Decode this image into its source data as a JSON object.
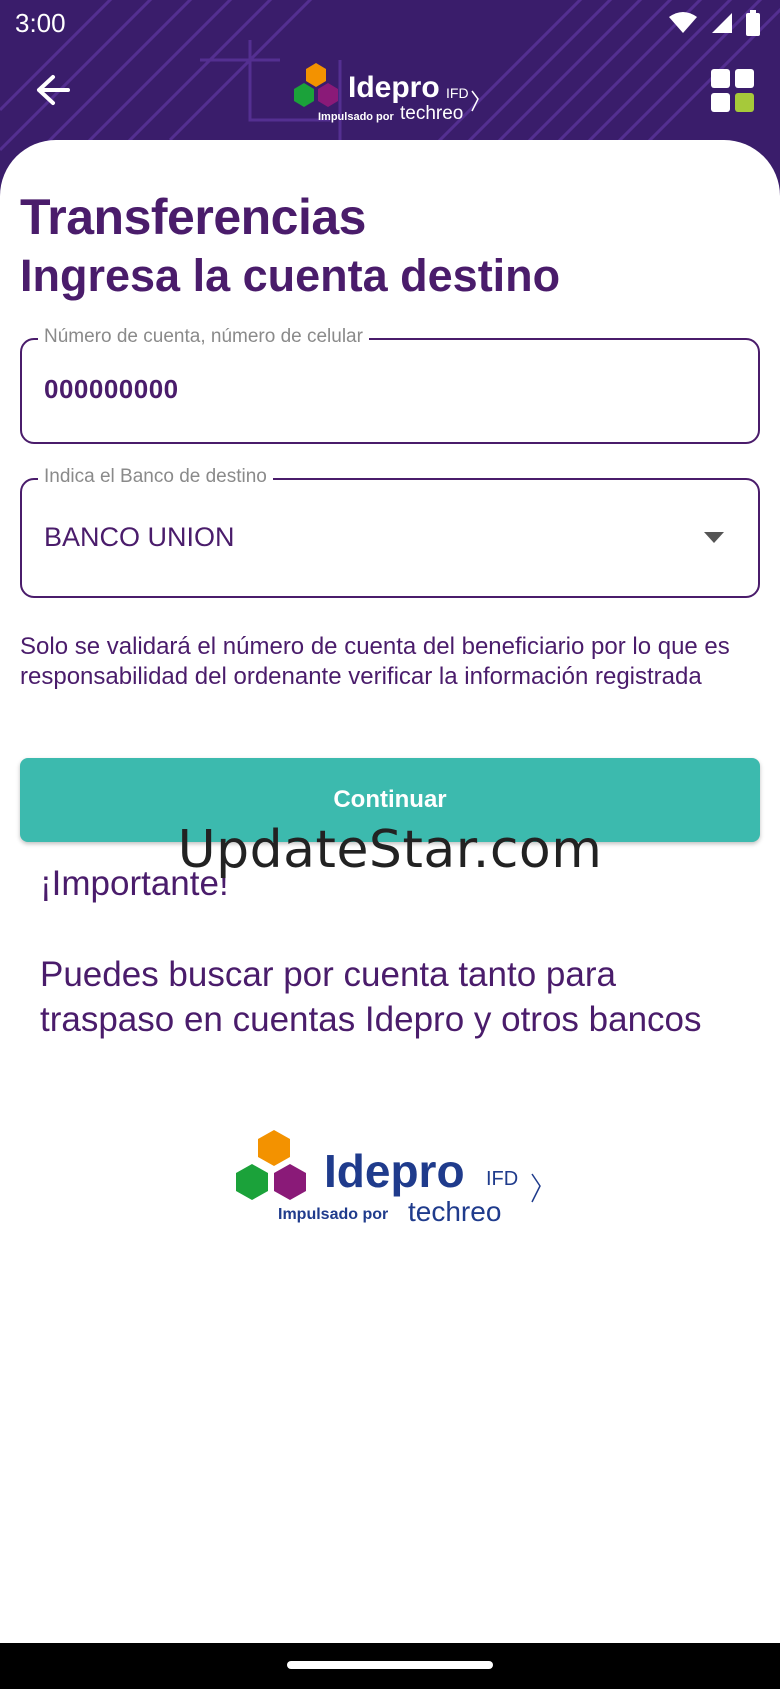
{
  "status_bar": {
    "time": "3:00"
  },
  "header": {
    "logo_brand": "Idepro",
    "logo_suffix": "IFD",
    "logo_tagline_prefix": "Impulsado por",
    "logo_tagline_brand": "techreo"
  },
  "main": {
    "title": "Transferencias",
    "subtitle": "Ingresa la cuenta destino",
    "account_field": {
      "label": "Número de cuenta, número de celular",
      "value": "000000000"
    },
    "bank_field": {
      "label": "Indica el Banco de destino",
      "selected": "BANCO UNION"
    },
    "disclaimer": "Solo se validará el número de cuenta del beneficiario por lo que es responsabilidad del ordenante verificar la información registrada",
    "continue_label": "Continuar",
    "watermark": "UpdateStar.com",
    "important_title": "¡Importante!",
    "important_body": "Puedes buscar por cuenta tanto para traspaso en cuentas Idepro y otros bancos"
  },
  "colors": {
    "primary": "#4a1c6b",
    "header_bg": "#3a1d6b",
    "accent": "#3cbaae",
    "logo_orange": "#f39200",
    "logo_green": "#1ba23a",
    "logo_purple": "#8a1a78",
    "logo_navy": "#1f3b8c"
  }
}
